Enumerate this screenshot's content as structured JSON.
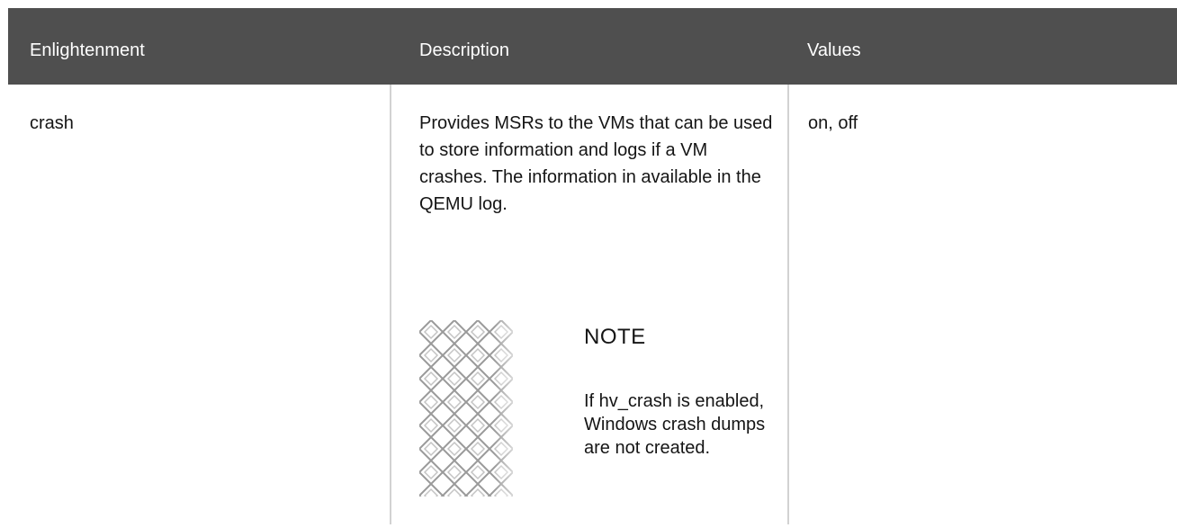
{
  "table": {
    "headers": [
      "Enlightenment",
      "Description",
      "Values"
    ],
    "rows": [
      {
        "enlightenment": "crash",
        "description": "Provides MSRs to the VMs that can be used to store information and logs if a VM crashes. The information in available in the QEMU log.",
        "values": "on, off",
        "note": {
          "icon": "diamond-pattern-icon",
          "title": "NOTE",
          "body": "If hv_crash is enabled, Windows crash dumps are not created."
        }
      }
    ]
  },
  "colors": {
    "header_bg": "#4f4f4f",
    "header_text": "#ffffff",
    "divider": "#d2d2d2",
    "body_text": "#151515"
  }
}
